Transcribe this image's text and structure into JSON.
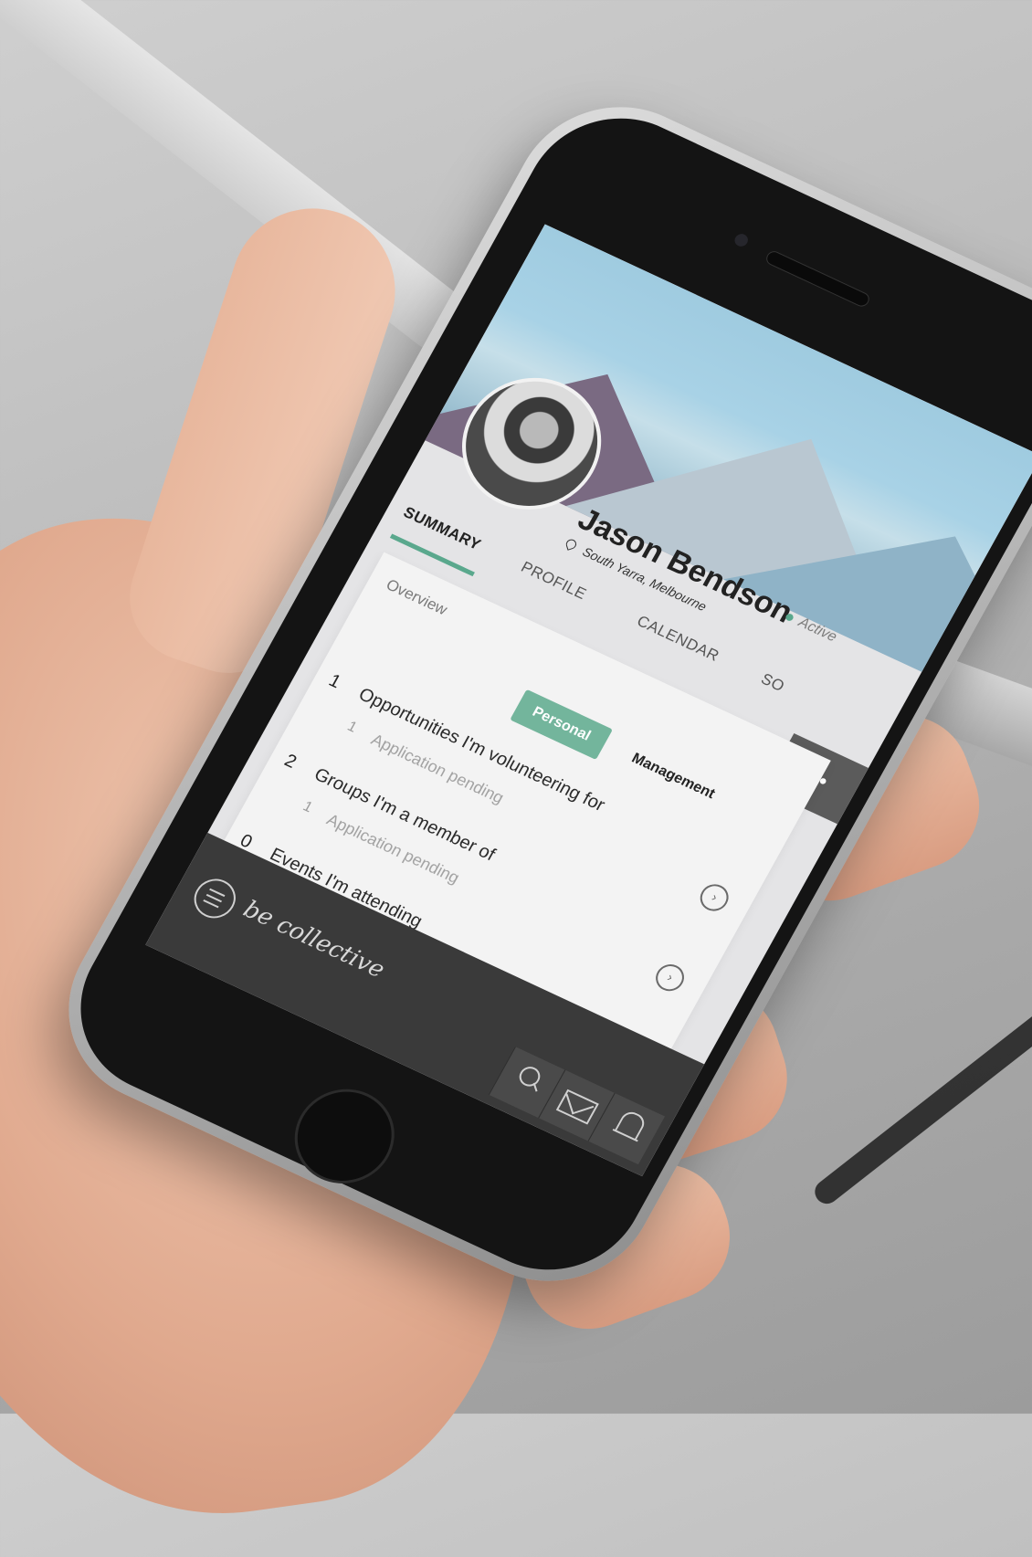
{
  "profile": {
    "name": "Jason Bendson",
    "status": "Active",
    "location": "South Yarra, Melbourne"
  },
  "tabs": [
    {
      "label": "SUMMARY",
      "active": true
    },
    {
      "label": "PROFILE",
      "active": false
    },
    {
      "label": "CALENDAR",
      "active": false
    },
    {
      "label": "SO",
      "active": false
    }
  ],
  "more_button": {
    "label": "•••"
  },
  "summary": {
    "section_title": "Overview",
    "segments": {
      "personal": "Personal",
      "management": "Management"
    },
    "rows": [
      {
        "count": "1",
        "label": "Opportunities I'm volunteering for",
        "sub_count": "1",
        "sub_label": "Application pending"
      },
      {
        "count": "2",
        "label": "Groups I'm a member of",
        "sub_count": "1",
        "sub_label": "Application pending"
      },
      {
        "count": "0",
        "label": "Events I'm attending"
      }
    ]
  },
  "bottom_nav": {
    "brand": "be collective"
  },
  "colors": {
    "accent": "#5aa88d",
    "nav": "#3a3a3a"
  },
  "icons": [
    "menu-icon",
    "search-icon",
    "mail-icon",
    "bell-icon",
    "location-pin-icon",
    "chevron-right-icon"
  ]
}
